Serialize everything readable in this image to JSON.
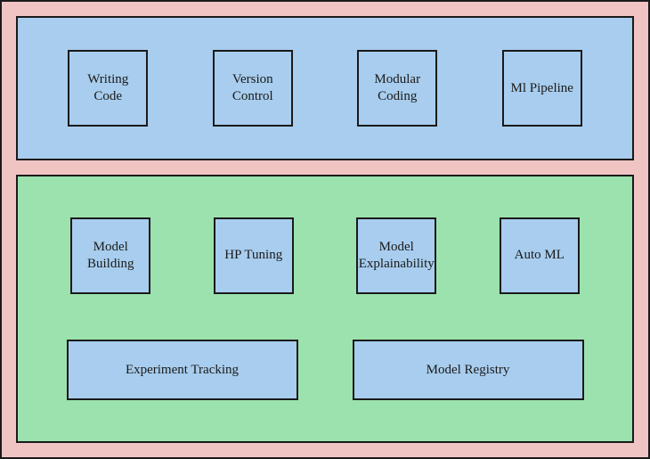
{
  "top": {
    "items": [
      {
        "label": "Writing Code"
      },
      {
        "label": "Version Control"
      },
      {
        "label": "Modular Coding"
      },
      {
        "label": "Ml Pipeline"
      }
    ]
  },
  "bottom": {
    "row1": [
      {
        "label": "Model Building"
      },
      {
        "label": "HP Tuning"
      },
      {
        "label": "Model Explainability"
      },
      {
        "label": "Auto ML"
      }
    ],
    "row2": [
      {
        "label": "Experiment Tracking"
      },
      {
        "label": "Model Registry"
      }
    ]
  },
  "colors": {
    "outer_bg": "#f1c4c4",
    "panel_blue": "#a8cdee",
    "panel_green": "#9be2ae",
    "border": "#1a1a1a"
  }
}
